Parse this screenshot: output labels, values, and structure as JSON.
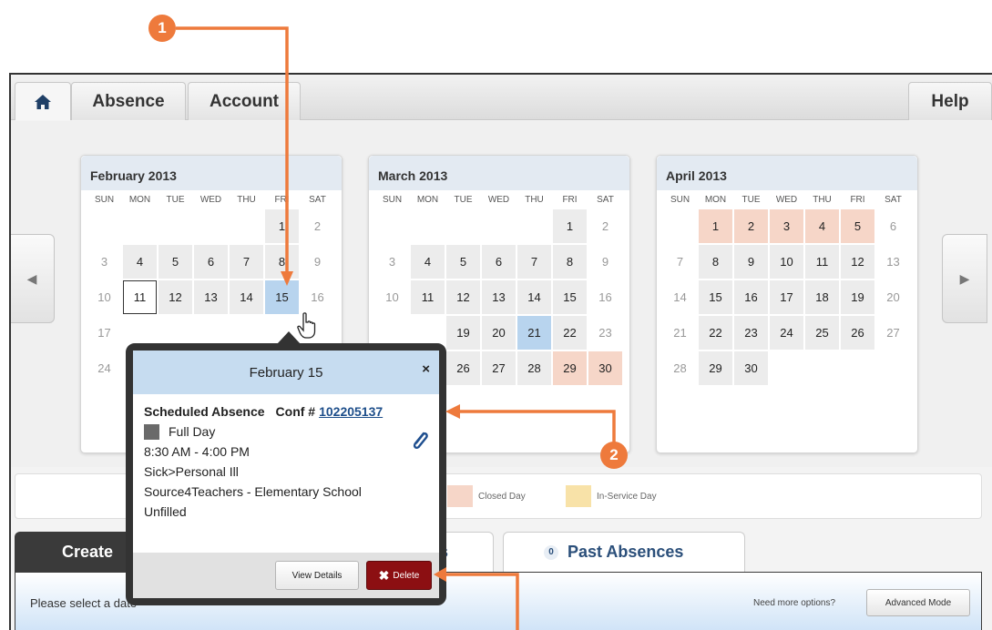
{
  "tabs": {
    "absence": "Absence",
    "account": "Account",
    "help": "Help"
  },
  "months": [
    {
      "title": "February 2013",
      "dow": [
        "SUN",
        "MON",
        "TUE",
        "WED",
        "THU",
        "FRI",
        "SAT"
      ],
      "weeks": [
        [
          "",
          "",
          "",
          "",
          "",
          "1",
          "2"
        ],
        [
          "3",
          "4",
          "5",
          "6",
          "7",
          "8",
          "9"
        ],
        [
          "10",
          "11",
          "12",
          "13",
          "14",
          "15",
          "16"
        ],
        [
          "17",
          "",
          "",
          "",
          "",
          "",
          ""
        ],
        [
          "24",
          "",
          "",
          "",
          "",
          "",
          ""
        ]
      ]
    },
    {
      "title": "March 2013",
      "dow": [
        "SUN",
        "MON",
        "TUE",
        "WED",
        "THU",
        "FRI",
        "SAT"
      ],
      "weeks": [
        [
          "",
          "",
          "",
          "",
          "",
          "1",
          "2"
        ],
        [
          "3",
          "4",
          "5",
          "6",
          "7",
          "8",
          "9"
        ],
        [
          "10",
          "11",
          "12",
          "13",
          "14",
          "15",
          "16"
        ],
        [
          "",
          "",
          "19",
          "20",
          "21",
          "22",
          "23"
        ],
        [
          "",
          "",
          "26",
          "27",
          "28",
          "29",
          "30"
        ]
      ]
    },
    {
      "title": "April 2013",
      "dow": [
        "SUN",
        "MON",
        "TUE",
        "WED",
        "THU",
        "FRI",
        "SAT"
      ],
      "weeks": [
        [
          "",
          "1",
          "2",
          "3",
          "4",
          "5",
          "6"
        ],
        [
          "7",
          "8",
          "9",
          "10",
          "11",
          "12",
          "13"
        ],
        [
          "14",
          "15",
          "16",
          "17",
          "18",
          "19",
          "20"
        ],
        [
          "21",
          "22",
          "23",
          "24",
          "25",
          "26",
          "27"
        ],
        [
          "28",
          "29",
          "30",
          "",
          "",
          "",
          ""
        ]
      ]
    }
  ],
  "legend": {
    "closed": "Closed Day",
    "inservice": "In-Service Day"
  },
  "bottom_tabs": {
    "create": "Create",
    "scheduled": "nces",
    "past": "Past Absences",
    "past_count": "0"
  },
  "bottom_bar": {
    "prompt": "Please select a date",
    "more": "Need more options?",
    "advanced": "Advanced Mode"
  },
  "popup": {
    "title": "February 15",
    "close": "×",
    "heading": "Scheduled Absence",
    "conf_label": "Conf #",
    "conf_number": "102205137",
    "duration": "Full Day",
    "time": "8:30 AM - 4:00 PM",
    "reason": "Sick>Personal Ill",
    "location": "Source4Teachers - Elementary School",
    "status": "Unfilled",
    "view_details": "View Details",
    "delete": "Delete"
  },
  "callouts": [
    "1",
    "2"
  ],
  "colors": {
    "closed": "#f6d6c8",
    "selected": "#b8d4ee",
    "inservice": "#f8e2a8",
    "annotation": "#ee7a3c",
    "delete": "#8c0f12"
  }
}
